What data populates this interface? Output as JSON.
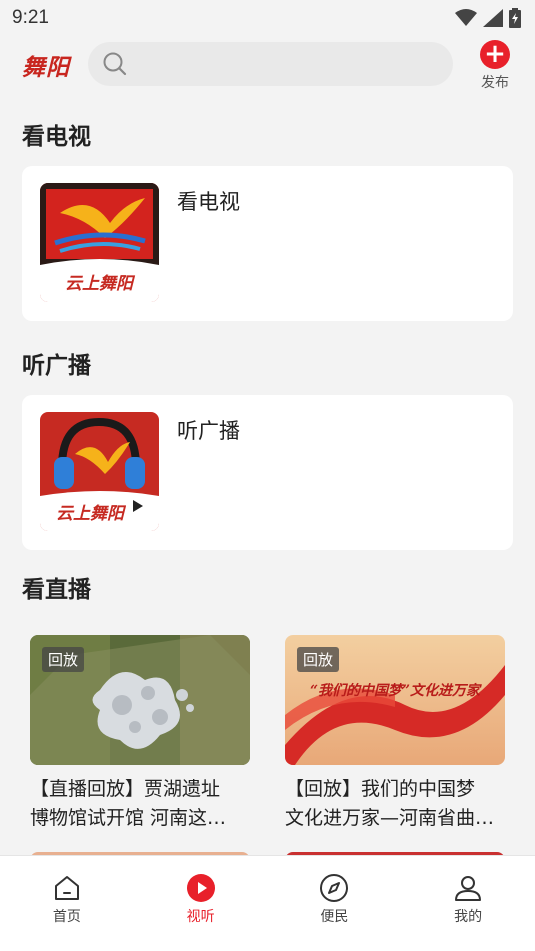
{
  "status_bar": {
    "time": "9:21"
  },
  "header": {
    "logo": "舞阳",
    "search_placeholder": "",
    "publish_label": "发布"
  },
  "sections": {
    "tv": {
      "title": "看电视",
      "card_label": "看电视",
      "thumb_caption": "云上舞阳"
    },
    "radio": {
      "title": "听广播",
      "card_label": "听广播",
      "thumb_caption": "云上舞阳"
    },
    "live": {
      "title": "看直播",
      "items": [
        {
          "badge": "回放",
          "title_line1": "【直播回放】贾湖遗址",
          "title_line2": "博物馆试开馆 河南这…"
        },
        {
          "badge": "回放",
          "title_line1": "【回放】我们的中国梦",
          "title_line2": "文化进万家—河南省曲…",
          "thumb_text": "“我们的中国梦”文化进万家"
        }
      ]
    }
  },
  "bottom_nav": {
    "items": [
      {
        "label": "首页",
        "icon": "home-icon"
      },
      {
        "label": "视听",
        "icon": "play-icon",
        "active": true
      },
      {
        "label": "便民",
        "icon": "compass-icon"
      },
      {
        "label": "我的",
        "icon": "user-icon"
      }
    ]
  },
  "colors": {
    "accent": "#e8202a",
    "brand": "#c8261f"
  }
}
